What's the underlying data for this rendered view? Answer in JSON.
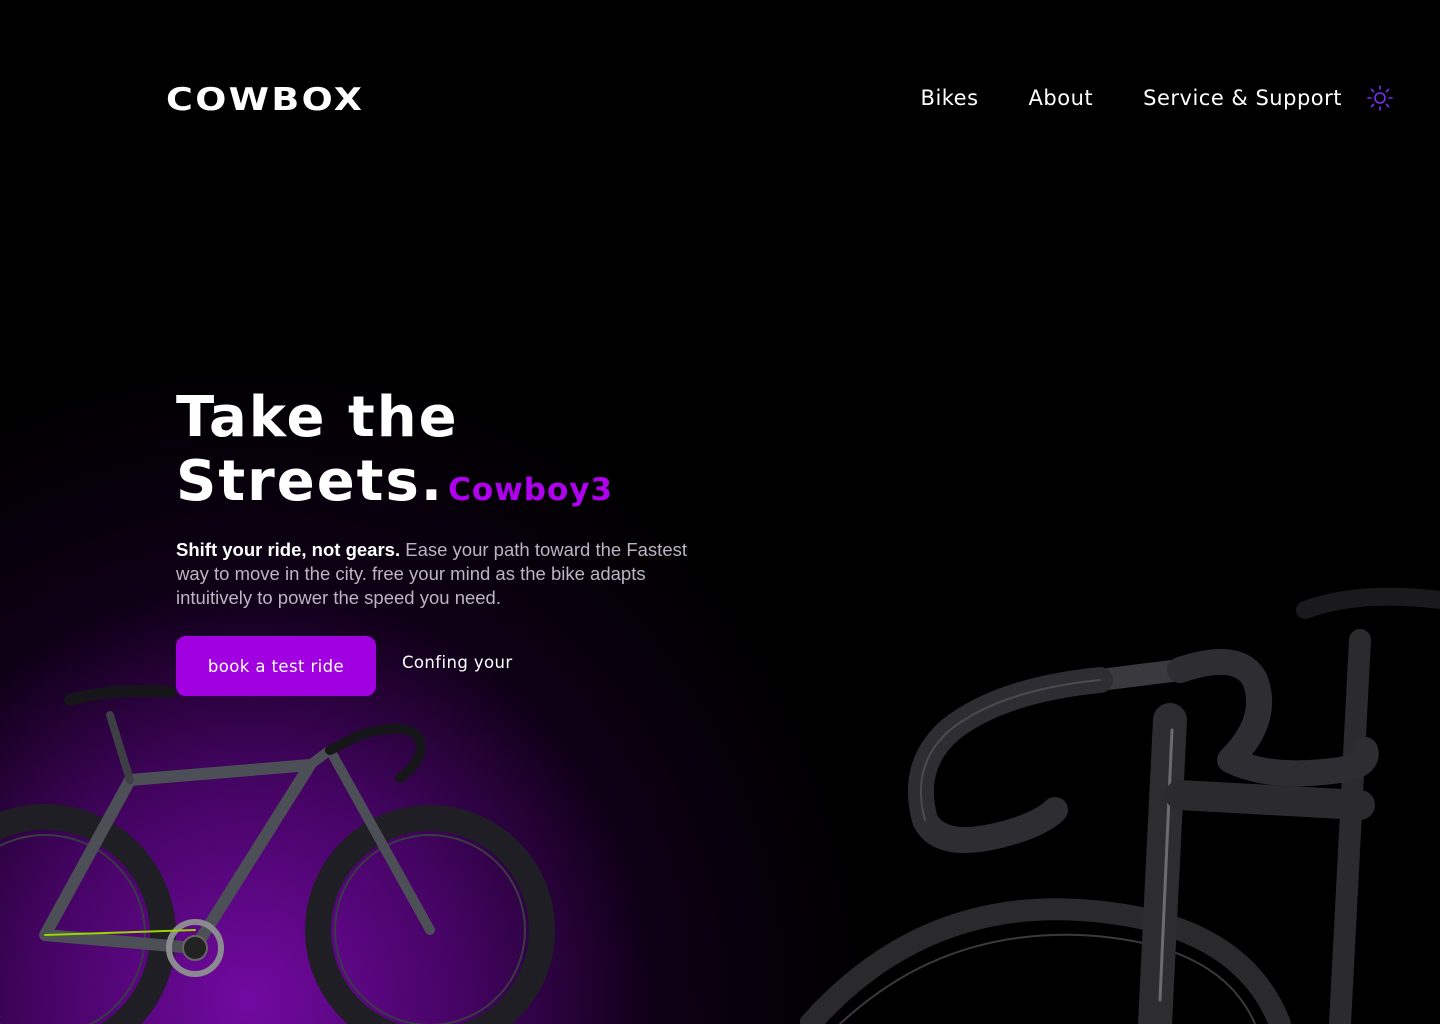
{
  "header": {
    "logo": "COWBOX",
    "nav": [
      {
        "label": "Bikes"
      },
      {
        "label": "About"
      },
      {
        "label": "Service & Support"
      }
    ],
    "theme_icon": "sun-icon"
  },
  "hero": {
    "title_line1": "Take the",
    "title_line2": "Streets.",
    "brand": "Cowboy3",
    "desc_bold": "Shift your ride, not gears.",
    "desc_text": " Ease your path toward the Fastest way to move in the city. free your mind as the bike adapts intuitively to power the speed you need.",
    "cta_primary": "book a test ride",
    "cta_secondary": "Confing your"
  },
  "colors": {
    "accent": "#a100e0",
    "brand_text": "#b000f0",
    "background": "#000000",
    "glow": "#7a0aaa",
    "icon_stroke": "#7b2ff7"
  }
}
